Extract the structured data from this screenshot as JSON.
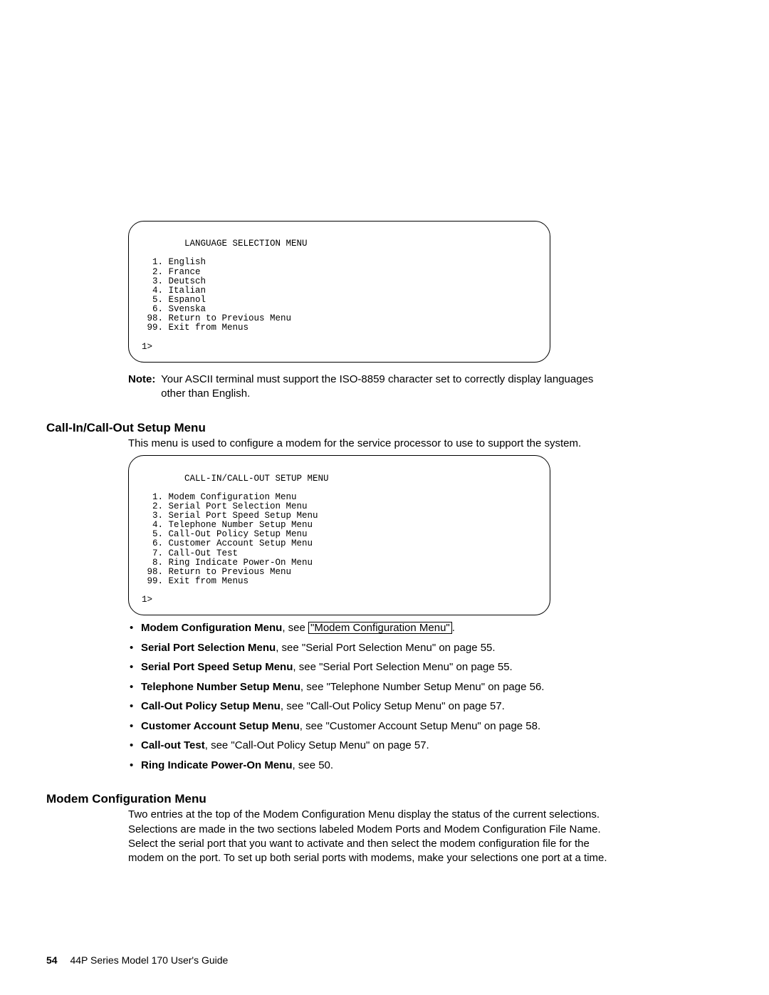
{
  "terminal1": {
    "title": "        LANGUAGE SELECTION MENU",
    "lines": [
      "  1. English",
      "  2. France",
      "  3. Deutsch",
      "  4. Italian",
      "  5. Espanol",
      "  6. Svenska",
      " 98. Return to Previous Menu",
      " 99. Exit from Menus"
    ],
    "prompt": "1>"
  },
  "note": {
    "label": "Note:",
    "text": "Your ASCII terminal must support the ISO-8859 character set to correctly display languages other than English."
  },
  "section1": {
    "heading": "Call-In/Call-Out Setup Menu",
    "para": "This menu is used to configure a modem for the service processor to use to support the system."
  },
  "terminal2": {
    "title": "        CALL-IN/CALL-OUT SETUP MENU",
    "lines": [
      "  1. Modem Configuration Menu",
      "  2. Serial Port Selection Menu",
      "  3. Serial Port Speed Setup Menu",
      "  4. Telephone Number Setup Menu",
      "  5. Call-Out Policy Setup Menu",
      "  6. Customer Account Setup Menu",
      "  7. Call-Out Test",
      "  8. Ring Indicate Power-On Menu",
      " 98. Return to Previous Menu",
      " 99. Exit from Menus"
    ],
    "prompt": "1>"
  },
  "bullets": [
    {
      "bold": "Modem Configuration Menu",
      "mid": ", see ",
      "link": "\"Modem Configuration Menu\"",
      "rest": "."
    },
    {
      "bold": "Serial Port Selection Menu",
      "mid": ", see \"Serial Port Selection Menu\" on page 55.",
      "link": "",
      "rest": ""
    },
    {
      "bold": "Serial Port Speed Setup Menu",
      "mid": ", see \"Serial Port Selection Menu\" on page 55.",
      "link": "",
      "rest": ""
    },
    {
      "bold": "Telephone Number Setup Menu",
      "mid": ", see \"Telephone Number Setup Menu\" on page 56.",
      "link": "",
      "rest": ""
    },
    {
      "bold": "Call-Out Policy Setup Menu",
      "mid": ", see \"Call-Out Policy Setup Menu\" on page 57.",
      "link": "",
      "rest": ""
    },
    {
      "bold": "Customer Account Setup Menu",
      "mid": ", see \"Customer Account Setup Menu\" on page 58.",
      "link": "",
      "rest": ""
    },
    {
      "bold": "Call-out Test",
      "mid": ", see \"Call-Out Policy Setup Menu\" on page 57.",
      "link": "",
      "rest": ""
    },
    {
      "bold": "Ring Indicate Power-On Menu",
      "mid": ", see 50.",
      "link": "",
      "rest": ""
    }
  ],
  "section2": {
    "heading": "Modem Configuration Menu",
    "para": "Two entries at the top of the Modem Configuration Menu display the status of the current selections. Selections are made in the two sections labeled Modem Ports and Modem Configuration File Name. Select the serial port that you want to activate and then select the modem configuration file for the modem on the port. To set up both serial ports with modems, make your selections one port at a time."
  },
  "footer": {
    "page": "54",
    "title": "44P Series Model 170 User's Guide"
  }
}
